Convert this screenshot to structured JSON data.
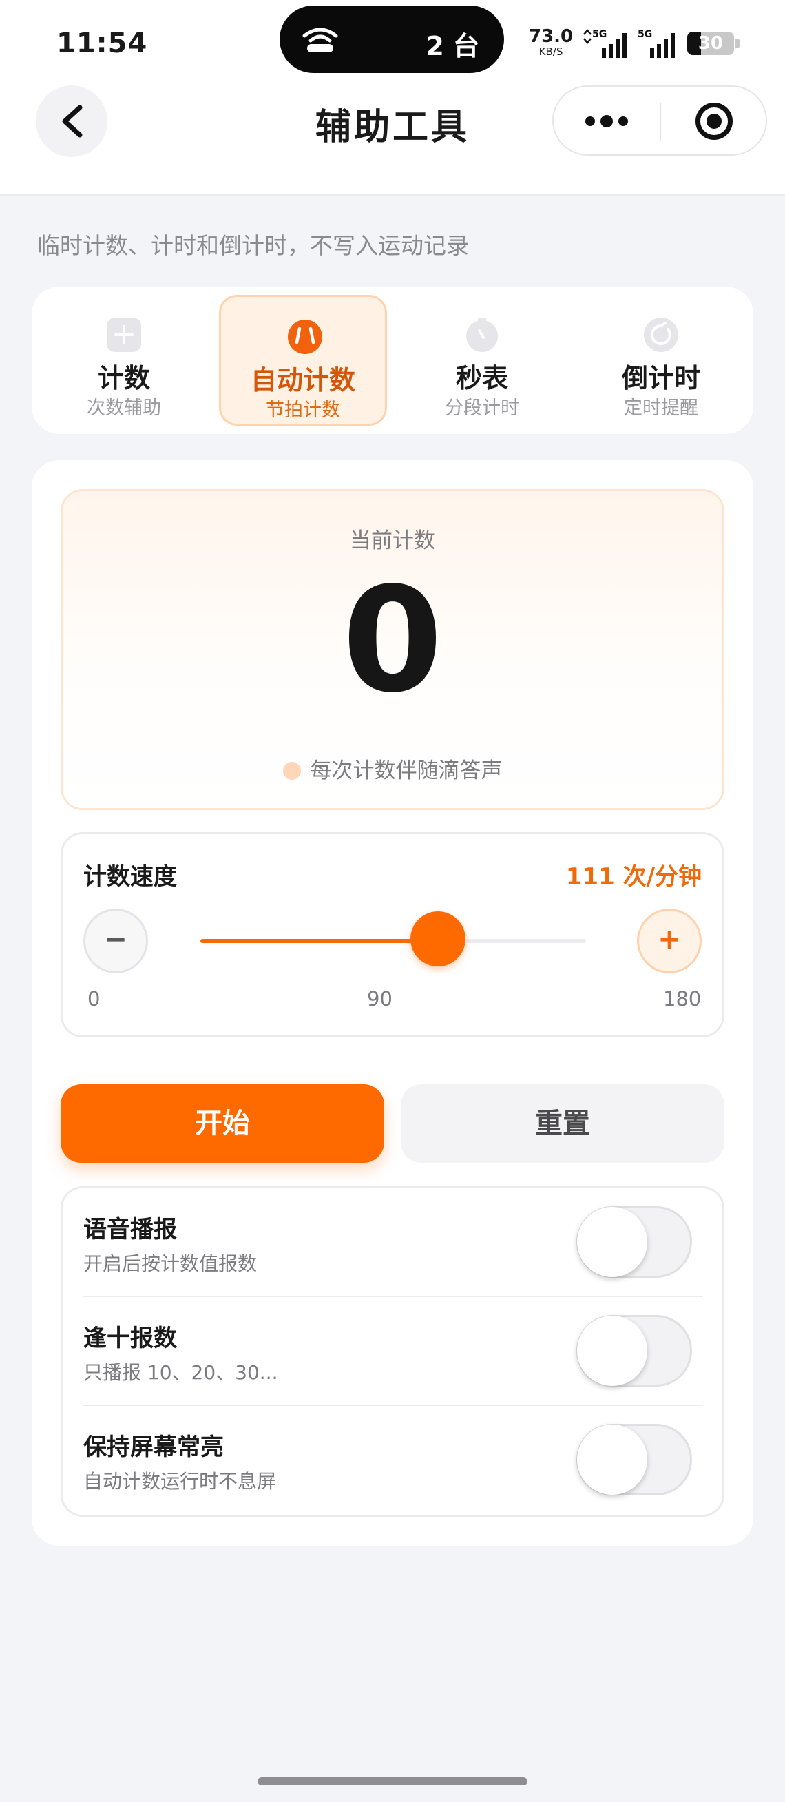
{
  "status_bar": {
    "time": "11:54",
    "hotspot_devices": "2 台",
    "net_speed_value": "73.0",
    "net_speed_unit": "KB/S",
    "sim1_label": "5G",
    "sim2_label": "5G",
    "battery_level": "30"
  },
  "nav": {
    "title": "辅助工具"
  },
  "subtitle": "临时计数、计时和倒计时，不写入运动记录",
  "tabs": [
    {
      "title": "计数",
      "sub": "次数辅助",
      "icon": "plus-icon"
    },
    {
      "title": "自动计数",
      "sub": "节拍计数",
      "icon": "metronome-icon",
      "active": true
    },
    {
      "title": "秒表",
      "sub": "分段计时",
      "icon": "stopwatch-icon"
    },
    {
      "title": "倒计时",
      "sub": "定时提醒",
      "icon": "timer-icon"
    }
  ],
  "counter": {
    "label": "当前计数",
    "value": "0",
    "hint": "每次计数伴随滴答声"
  },
  "speed": {
    "label": "计数速度",
    "value_text": "111 次/分钟",
    "value": 111,
    "min": 0,
    "max": 180,
    "ticks": [
      "0",
      "90",
      "180"
    ],
    "minus_label": "−",
    "plus_label": "+"
  },
  "actions": {
    "start_label": "开始",
    "reset_label": "重置"
  },
  "settings": [
    {
      "title": "语音播报",
      "desc": "开启后按计数值报数",
      "enabled": false
    },
    {
      "title": "逢十报数",
      "desc": "只播报 10、20、30...",
      "enabled": false
    },
    {
      "title": "保持屏幕常亮",
      "desc": "自动计数运行时不息屏",
      "enabled": false
    }
  ],
  "colors": {
    "accent": "#ff6a00",
    "accent_text": "#f06a0a",
    "active_tab_bg": "#fff1e4"
  }
}
